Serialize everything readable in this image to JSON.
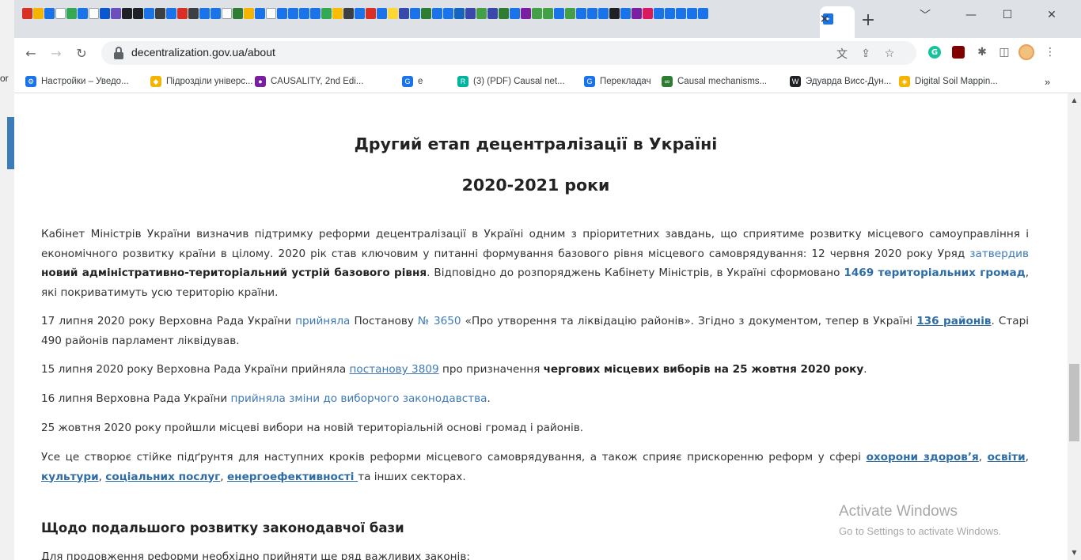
{
  "background": {
    "left_text": "or"
  },
  "browser": {
    "tab_close_glyph": "✕",
    "new_tab_glyph": "+",
    "window_controls": [
      "﹀",
      "—",
      "☐",
      "✕"
    ],
    "url": "decentralization.gov.ua/about",
    "favicon_strip_colors": [
      "#d93025",
      "#f5b400",
      "#1a73e8",
      "#ffffff",
      "#34a853",
      "#1a73e8",
      "#ffffff",
      "#0b57d0",
      "#6b4fbb",
      "#202124",
      "#202124",
      "#1a73e8",
      "#3c4043",
      "#1a73e8",
      "#d93025",
      "#3c4043",
      "#1a73e8",
      "#1a73e8",
      "#ffffff",
      "#2e7d32",
      "#f5b400",
      "#1a73e8",
      "#ffffff",
      "#1a73e8",
      "#1a73e8",
      "#1a73e8",
      "#1a73e8",
      "#34a853",
      "#fbbc05",
      "#3c4043",
      "#1a73e8",
      "#d93025",
      "#1a73e8",
      "#fdd835",
      "#3949ab",
      "#1a73e8",
      "#2e7d32",
      "#1a73e8",
      "#1a73e8",
      "#1565c0",
      "#3949ab",
      "#43a047",
      "#3949ab",
      "#2e7d32",
      "#1a73e8",
      "#7b1fa2",
      "#43a047",
      "#43a047",
      "#1a73e8",
      "#43a047",
      "#1a73e8",
      "#1a73e8",
      "#1a73e8",
      "#202124",
      "#1a73e8",
      "#7b1fa2",
      "#d81b60",
      "#1a73e8",
      "#1a73e8",
      "#1a73e8",
      "#1a73e8",
      "#1a73e8"
    ],
    "bookmarks": [
      {
        "label": "Настройки – Уведо...",
        "icon": "gear-icon",
        "color": "#1a73e8"
      },
      {
        "label": "Підрозділи універс...",
        "icon": "shield-icon",
        "color": "#f5b400"
      },
      {
        "label": "CAUSALITY, 2nd Edi...",
        "icon": "circle-icon",
        "color": "#7b1fa2"
      },
      {
        "label": "e",
        "icon": "translate-icon",
        "color": "#1a73e8"
      },
      {
        "label": "(3) (PDF) Causal net...",
        "icon": "researchgate-icon",
        "color": "#00b39f"
      },
      {
        "label": "Перекладач",
        "icon": "translate-icon",
        "color": "#1a73e8"
      },
      {
        "label": "Causal mechanisms...",
        "icon": "stanford-icon",
        "color": "#2e7d32"
      },
      {
        "label": "Эдуарда Висс-Дун...",
        "icon": "wikipedia-icon",
        "color": "#202124"
      },
      {
        "label": "Digital Soil Mappin...",
        "icon": "bookmark-icon",
        "color": "#f5b400"
      }
    ],
    "bookmarks_more": "»"
  },
  "article": {
    "title_line1": "Другий етап децентралізації в Україні",
    "title_line2": "2020-2021 роки",
    "p1": {
      "t1": "Кабінет Міністрів України визначив підтримку реформи децентралізації в Україні одним з пріоритетних завдань, що сприятиме розвитку місцевого самоуправління і економічного розвитку країни в цілому. 2020 рік став ключовим у питанні формування базового рівня місцевого самоврядування: 12 червня 2020 року Уряд ",
      "link1": "затвердив",
      "t2": " ",
      "b1": "новий адміністративно-територіальний устрій базового рівня",
      "t3": ". Відповідно до розпоряджень Кабінету Міністрів, в Україні сформовано ",
      "link2": "1469 територіальних громад",
      "t4": ", які покриватимуть усю територію країни."
    },
    "p2": {
      "t1": "17 липня 2020 року Верховна Рада України ",
      "link1": "прийняла",
      "t2": " Постанову ",
      "link2": "№ 3650",
      "t3": " «Про утворення та ліквідацію районів». Згідно з документом, тепер в Україні ",
      "link3": "136 районів",
      "t4": ". Старі 490 районів парламент ліквідував."
    },
    "p3": {
      "t1": "15 липня 2020 року Верховна Рада України прийняла ",
      "link1": "постанову 3809",
      "t2": " про призначення ",
      "b1": "чергових місцевих виборів на 25 жовтня 2020 року",
      "t3": "."
    },
    "p4": {
      "t1": "16 липня Верховна Рада України ",
      "link1": "прийняла зміни до виборчого законодавства",
      "t2": "."
    },
    "p5": {
      "t1": "25 жовтня 2020 року пройшли місцеві вибори на новій територіальній основі громад і районів."
    },
    "p6": {
      "t1": "Усе це створює стійке підґрунтя для наступних кроків реформи місцевого самоврядування, а також сприяє прискоренню реформ у сфері ",
      "link1": "охорони здоров’я",
      "s1": ", ",
      "link2": "освіти",
      "s2": ", ",
      "link3": "культури",
      "s3": ", ",
      "link4": "соціальних послуг",
      "s4": ", ",
      "link5": "енергоефективності ",
      "t2": "та інших секторах."
    },
    "subheading": "Щодо подальшого розвитку законодавчої бази",
    "p7": "Для продовження реформи необхідно прийняти ще ряд важливих законів:"
  },
  "watermark": {
    "line1": "Activate Windows",
    "line2": "Go to Settings to activate Windows."
  }
}
